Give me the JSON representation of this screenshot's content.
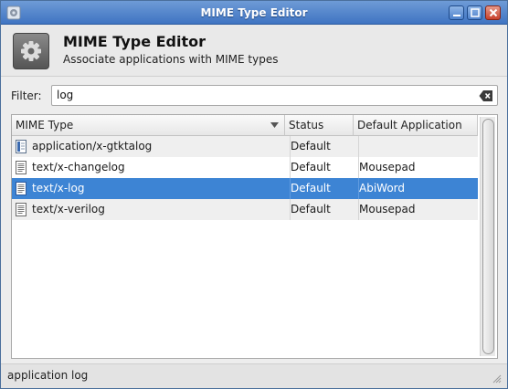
{
  "window": {
    "title": "MIME Type Editor"
  },
  "header": {
    "title": "MIME Type Editor",
    "subtitle": "Associate applications with MIME types",
    "icon": "gear-icon"
  },
  "filter": {
    "label": "Filter:",
    "value": "log",
    "clear_icon": "clear-backspace-icon"
  },
  "table": {
    "columns": [
      "MIME Type",
      "Status",
      "Default Application"
    ],
    "sort_column": "MIME Type",
    "rows": [
      {
        "mime": "application/x-gtktalog",
        "status": "Default",
        "app": "",
        "icon": "binary-file-icon"
      },
      {
        "mime": "text/x-changelog",
        "status": "Default",
        "app": "Mousepad",
        "icon": "text-file-icon"
      },
      {
        "mime": "text/x-log",
        "status": "Default",
        "app": "AbiWord",
        "icon": "text-file-icon",
        "selected": true
      },
      {
        "mime": "text/x-verilog",
        "status": "Default",
        "app": "Mousepad",
        "icon": "text-file-icon"
      }
    ]
  },
  "statusbar": {
    "text": "application log"
  },
  "colors": {
    "titlebar": "#3f74c2",
    "selection": "#3d84d4"
  }
}
